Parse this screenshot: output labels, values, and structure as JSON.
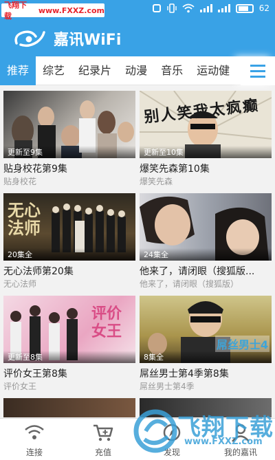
{
  "watermark_top": {
    "site": "飞翔下载",
    "url": "www.FXXZ.com"
  },
  "status_bar": {
    "battery": "62"
  },
  "app": {
    "title": "嘉讯WiFi"
  },
  "tabs": [
    "推荐",
    "综艺",
    "纪录片",
    "动漫",
    "音乐",
    "运动健"
  ],
  "cards": [
    {
      "badge": "更新至9集",
      "title": "贴身校花第9集",
      "subtitle": "贴身校花"
    },
    {
      "badge": "更新至10集",
      "title": "爆笑先森第10集",
      "subtitle": "爆笑先森",
      "poster_text": "别人笑我太疯癫"
    },
    {
      "badge": "20集全",
      "title": "无心法师第20集",
      "subtitle": "无心法师",
      "poster_text": "无心法师"
    },
    {
      "badge": "24集全",
      "title": "他来了，请闭眼（搜狐版...",
      "subtitle": "他来了，请闭眼（搜狐版）"
    },
    {
      "badge": "更新至8集",
      "title": "评价女王第8集",
      "subtitle": "评价女王",
      "poster_text": "评价女王"
    },
    {
      "badge": "8集全",
      "title": "屌丝男士第4季第8集",
      "subtitle": "屌丝男士第4季",
      "poster_text": "屌丝男士4"
    }
  ],
  "bottom_nav": [
    "连接",
    "充值",
    "发现",
    "我的嘉讯"
  ],
  "watermark_bottom": {
    "text": "飞翔下载",
    "url": "www.FXXZ.com"
  },
  "colors": {
    "accent": "#39a2e6",
    "watermark_red": "#e8232b"
  }
}
